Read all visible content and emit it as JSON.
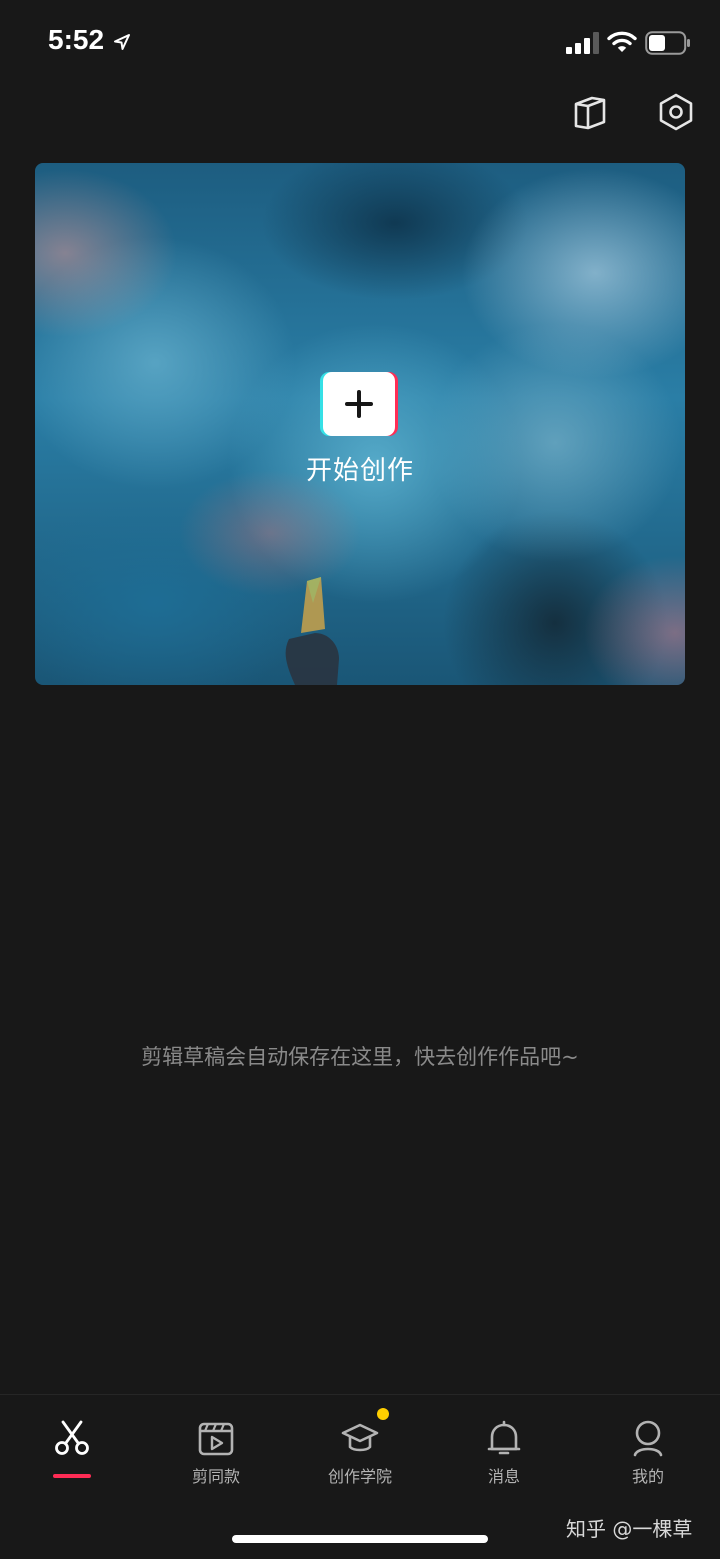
{
  "status_bar": {
    "time": "5:52",
    "icons": [
      "location-arrow-icon",
      "cellular-signal-icon",
      "wifi-icon",
      "battery-icon"
    ]
  },
  "header": {
    "icons": [
      "tutorial-book-icon",
      "settings-hexagon-icon"
    ]
  },
  "hero": {
    "button_icon": "plus-icon",
    "label": "开始创作"
  },
  "empty_state": {
    "message": "剪辑草稿会自动保存在这里，快去创作作品吧~"
  },
  "tab_bar": {
    "active_index": 0,
    "accent_color": "#fe2c55",
    "badge_color": "#ffcf00",
    "tabs": [
      {
        "label": "",
        "icon": "scissors-icon"
      },
      {
        "label": "剪同款",
        "icon": "clapperboard-play-icon"
      },
      {
        "label": "创作学院",
        "icon": "graduation-cap-icon"
      },
      {
        "label": "消息",
        "icon": "bell-icon"
      },
      {
        "label": "我的",
        "icon": "person-icon"
      }
    ]
  },
  "watermark": "知乎 @一棵草"
}
